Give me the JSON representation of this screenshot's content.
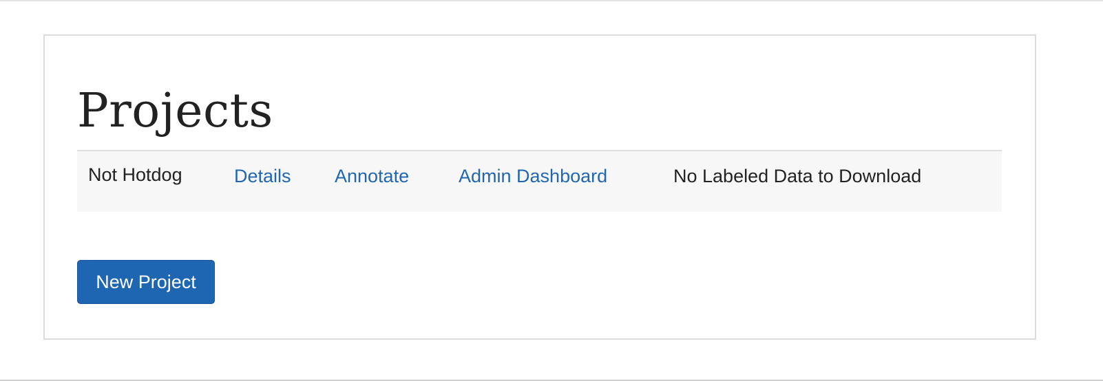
{
  "page": {
    "title": "Projects"
  },
  "projects": [
    {
      "name": "Not Hotdog",
      "details_label": "Details",
      "annotate_label": "Annotate",
      "admin_label": "Admin Dashboard",
      "download_status": "No Labeled Data to Download"
    }
  ],
  "actions": {
    "new_project_label": "New Project"
  },
  "colors": {
    "link": "#2166b0",
    "primary_button": "#1f66b2",
    "row_background": "#f7f7f7"
  }
}
